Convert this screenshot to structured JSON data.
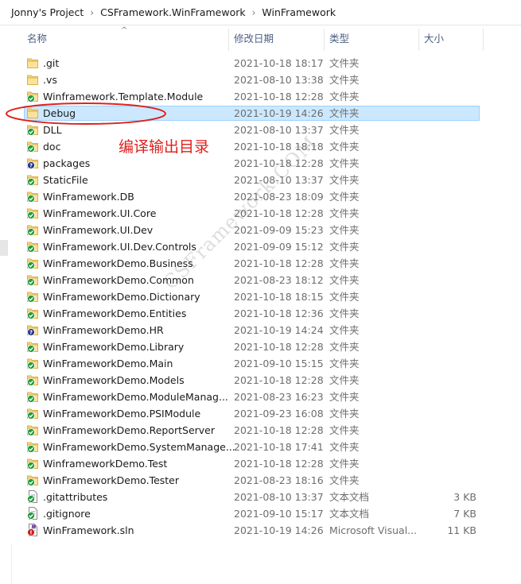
{
  "breadcrumb": [
    "Jonny's Project",
    "CSFramework.WinFramework",
    "WinFramework"
  ],
  "breadcrumb_separator": "›",
  "columns": {
    "name": "名称",
    "date": "修改日期",
    "type": "类型",
    "size": "大小"
  },
  "annotation": "编译输出目录",
  "watermark": "CSFramework.COM",
  "files": [
    {
      "name": ".git",
      "date": "2021-10-18 18:17",
      "type": "文件夹",
      "size": "",
      "icon": "folder-icon"
    },
    {
      "name": ".vs",
      "date": "2021-08-10 13:38",
      "type": "文件夹",
      "size": "",
      "icon": "folder-icon"
    },
    {
      "name": "Winframework.Template.Module",
      "date": "2021-10-18 12:28",
      "type": "文件夹",
      "size": "",
      "icon": "folder-sync-ok-icon"
    },
    {
      "name": "Debug",
      "date": "2021-10-19 14:26",
      "type": "文件夹",
      "size": "",
      "icon": "folder-icon",
      "selected": true
    },
    {
      "name": "DLL",
      "date": "2021-08-10 13:37",
      "type": "文件夹",
      "size": "",
      "icon": "folder-sync-ok-icon"
    },
    {
      "name": "doc",
      "date": "2021-10-18 18:18",
      "type": "文件夹",
      "size": "",
      "icon": "folder-sync-ok-icon"
    },
    {
      "name": "packages",
      "date": "2021-10-18 12:28",
      "type": "文件夹",
      "size": "",
      "icon": "folder-sync-unknown-icon"
    },
    {
      "name": "StaticFile",
      "date": "2021-08-10 13:37",
      "type": "文件夹",
      "size": "",
      "icon": "folder-sync-ok-icon"
    },
    {
      "name": "WinFramework.DB",
      "date": "2021-08-23 18:09",
      "type": "文件夹",
      "size": "",
      "icon": "folder-sync-ok-icon"
    },
    {
      "name": "WinFramework.UI.Core",
      "date": "2021-10-18 12:28",
      "type": "文件夹",
      "size": "",
      "icon": "folder-sync-ok-icon"
    },
    {
      "name": "WinFramework.UI.Dev",
      "date": "2021-09-09 15:23",
      "type": "文件夹",
      "size": "",
      "icon": "folder-sync-ok-icon"
    },
    {
      "name": "WinFramework.UI.Dev.Controls",
      "date": "2021-09-09 15:12",
      "type": "文件夹",
      "size": "",
      "icon": "folder-sync-ok-icon"
    },
    {
      "name": "WinFrameworkDemo.Business",
      "date": "2021-10-18 12:28",
      "type": "文件夹",
      "size": "",
      "icon": "folder-sync-ok-icon"
    },
    {
      "name": "WinFrameworkDemo.Common",
      "date": "2021-08-23 18:12",
      "type": "文件夹",
      "size": "",
      "icon": "folder-sync-ok-icon"
    },
    {
      "name": "WinFrameworkDemo.Dictionary",
      "date": "2021-10-18 18:15",
      "type": "文件夹",
      "size": "",
      "icon": "folder-sync-ok-icon"
    },
    {
      "name": "WinFrameworkDemo.Entities",
      "date": "2021-10-18 12:36",
      "type": "文件夹",
      "size": "",
      "icon": "folder-sync-ok-icon"
    },
    {
      "name": "WinFrameworkDemo.HR",
      "date": "2021-10-19 14:24",
      "type": "文件夹",
      "size": "",
      "icon": "folder-sync-unknown-icon"
    },
    {
      "name": "WinFrameworkDemo.Library",
      "date": "2021-10-18 12:28",
      "type": "文件夹",
      "size": "",
      "icon": "folder-sync-ok-icon"
    },
    {
      "name": "WinFrameworkDemo.Main",
      "date": "2021-09-10 15:15",
      "type": "文件夹",
      "size": "",
      "icon": "folder-sync-ok-icon"
    },
    {
      "name": "WinFrameworkDemo.Models",
      "date": "2021-10-18 12:28",
      "type": "文件夹",
      "size": "",
      "icon": "folder-sync-ok-icon"
    },
    {
      "name": "WinFrameworkDemo.ModuleManag...",
      "date": "2021-08-23 16:23",
      "type": "文件夹",
      "size": "",
      "icon": "folder-sync-ok-icon"
    },
    {
      "name": "WinFrameworkDemo.PSIModule",
      "date": "2021-09-23 16:08",
      "type": "文件夹",
      "size": "",
      "icon": "folder-sync-ok-icon"
    },
    {
      "name": "WinFrameworkDemo.ReportServer",
      "date": "2021-10-18 12:28",
      "type": "文件夹",
      "size": "",
      "icon": "folder-sync-ok-icon"
    },
    {
      "name": "WinFrameworkDemo.SystemManage...",
      "date": "2021-10-18 17:41",
      "type": "文件夹",
      "size": "",
      "icon": "folder-sync-ok-icon"
    },
    {
      "name": "WinframeworkDemo.Test",
      "date": "2021-10-18 12:28",
      "type": "文件夹",
      "size": "",
      "icon": "folder-sync-ok-icon"
    },
    {
      "name": "WinFrameworkDemo.Tester",
      "date": "2021-08-23 18:16",
      "type": "文件夹",
      "size": "",
      "icon": "folder-sync-ok-icon"
    },
    {
      "name": ".gitattributes",
      "date": "2021-08-10 13:37",
      "type": "文本文档",
      "size": "3 KB",
      "icon": "text-file-sync-ok-icon"
    },
    {
      "name": ".gitignore",
      "date": "2021-09-10 15:17",
      "type": "文本文档",
      "size": "7 KB",
      "icon": "text-file-sync-ok-icon"
    },
    {
      "name": "WinFramework.sln",
      "date": "2021-10-19 14:26",
      "type": "Microsoft Visual...",
      "size": "11 KB",
      "icon": "sln-file-conflict-icon"
    }
  ]
}
